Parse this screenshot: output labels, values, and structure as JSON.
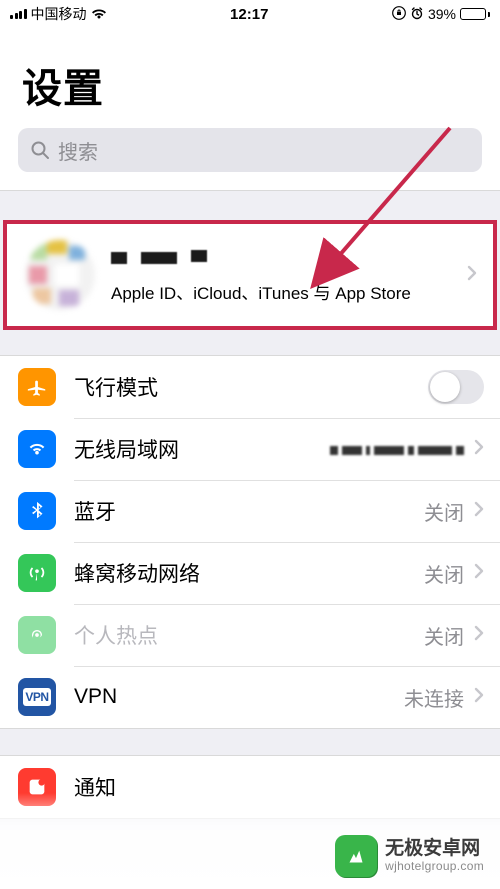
{
  "statusbar": {
    "carrier": "中国移动",
    "time": "12:17",
    "battery_pct": "39%",
    "battery_level": 39
  },
  "header": {
    "title": "设置"
  },
  "search": {
    "placeholder": "搜索"
  },
  "profile": {
    "subtitle": "Apple ID、iCloud、iTunes 与 App Store"
  },
  "settings": [
    {
      "key": "airplane",
      "label": "飞行模式",
      "value": "",
      "toggle": true
    },
    {
      "key": "wifi",
      "label": "无线局域网",
      "value": ""
    },
    {
      "key": "bluetooth",
      "label": "蓝牙",
      "value": "关闭"
    },
    {
      "key": "cellular",
      "label": "蜂窝移动网络",
      "value": "关闭"
    },
    {
      "key": "hotspot",
      "label": "个人热点",
      "value": "关闭",
      "disabled": true
    },
    {
      "key": "vpn",
      "label": "VPN",
      "value": "未连接"
    }
  ],
  "group2": [
    {
      "key": "notifications",
      "label": "通知"
    }
  ],
  "watermark": {
    "cn": "无极安卓网",
    "en": "wjhotelgroup.com"
  }
}
